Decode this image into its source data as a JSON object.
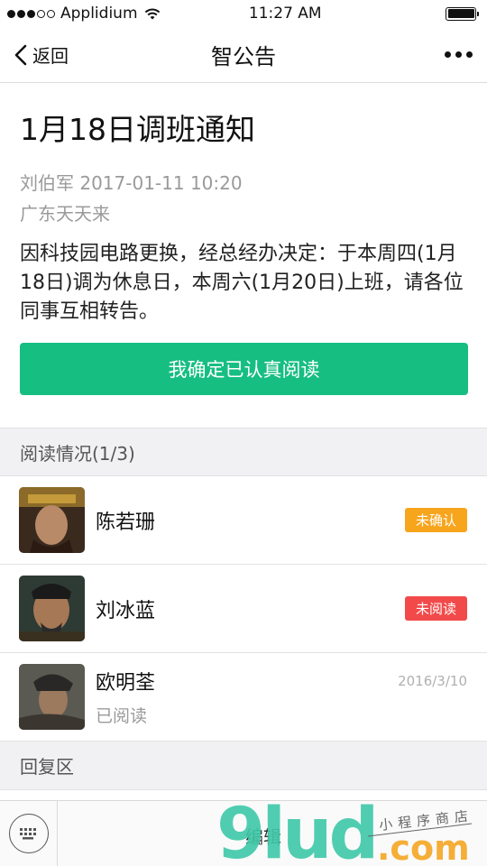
{
  "status_bar": {
    "carrier": "Applidium",
    "time": "11:27 AM",
    "icons": [
      "signal-dots-icon",
      "wifi-icon",
      "battery-icon"
    ]
  },
  "nav": {
    "back_label": "返回",
    "title": "智公告",
    "more_icon": "more-dots-icon"
  },
  "notice": {
    "title": "1月18日调班通知",
    "author_time": "刘伯军 2017-01-11 10:20",
    "company": "广东天天来",
    "body": "因科技园电路更换，经总经办决定：于本周四(1月18日)调为休息日，本周六(1月20日)上班，请各位同事互相转告。",
    "confirm_button": "我确定已认真阅读"
  },
  "read_status": {
    "header": "阅读情况(1/3)",
    "rows": [
      {
        "name": "陈若珊",
        "badge": "未确认",
        "badge_color": "#f7a51d"
      },
      {
        "name": "刘冰蓝",
        "badge": "未阅读",
        "badge_color": "#f24a4a"
      },
      {
        "name": "欧明荃",
        "status": "已阅读",
        "date": "2016/3/10"
      }
    ]
  },
  "reply": {
    "header": "回复区"
  },
  "bottom_bar": {
    "keyboard_icon": "keyboard-icon",
    "edit_label": "编辑"
  },
  "watermark": {
    "brand": "9lud",
    "domain": ".com",
    "tagline": "小程序商店"
  },
  "colors": {
    "accent": "#16be82",
    "badge_orange": "#f7a51d",
    "badge_red": "#f24a4a"
  }
}
